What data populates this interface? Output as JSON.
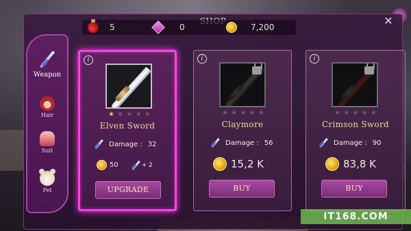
{
  "header": {
    "title": "SHOP",
    "close_label": "✕"
  },
  "currencies": [
    {
      "icon": "potion-icon",
      "value": "5"
    },
    {
      "icon": "gem-icon",
      "value": "0"
    },
    {
      "icon": "coin-icon",
      "value": "7,200"
    }
  ],
  "tabs": [
    {
      "label": "Weapon",
      "icon": "sword-icon",
      "active": true
    },
    {
      "label": "Hair",
      "icon": "hair-icon",
      "active": false
    },
    {
      "label": "Suit",
      "icon": "suit-icon",
      "active": false
    },
    {
      "label": "Pet",
      "icon": "pet-icon",
      "active": false
    }
  ],
  "items": [
    {
      "name": "Elven Sword",
      "stars_filled": 1,
      "stars_total": 5,
      "stat_label": "Damage :",
      "stat_value": "32",
      "price": "50",
      "bonus": "+ 2",
      "locked": false,
      "selected": true,
      "button_label": "UPGRADE"
    },
    {
      "name": "Claymore",
      "stars_filled": 0,
      "stars_total": 5,
      "stat_label": "Damage :",
      "stat_value": "56",
      "price": "15,2 K",
      "locked": true,
      "selected": false,
      "button_label": "BUY"
    },
    {
      "name": "Crimson Sword",
      "stars_filled": 0,
      "stars_total": 5,
      "stat_label": "Damage :",
      "stat_value": "90",
      "price": "83,8 K",
      "locked": true,
      "selected": false,
      "button_label": "BUY"
    }
  ],
  "info_label": "i",
  "watermark": "IT168.COM",
  "colors": {
    "accent": "#ff3fe7",
    "panel": "#3a1a40",
    "gold_text": "#f0d99a",
    "button": "#8f3a8a"
  }
}
